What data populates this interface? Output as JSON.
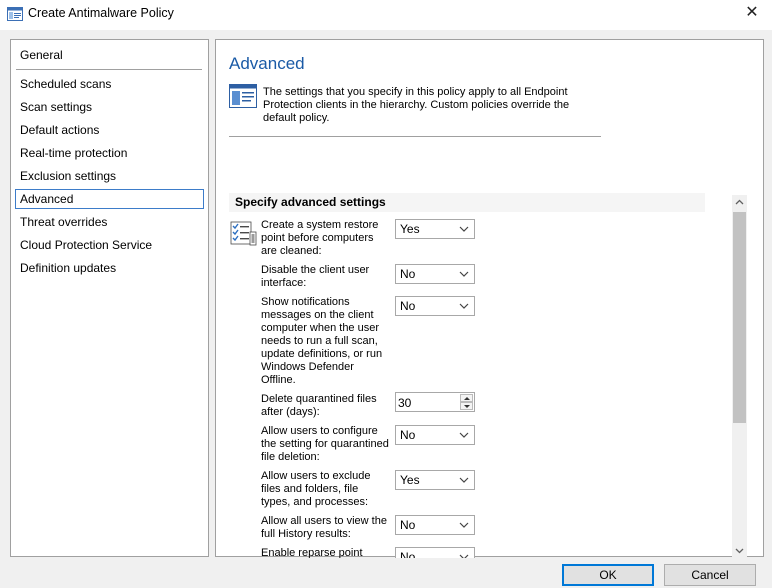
{
  "window": {
    "title": "Create Antimalware Policy",
    "close_glyph": "✕"
  },
  "nav": {
    "items": [
      {
        "label": "General",
        "selected": false
      },
      {
        "label": "Scheduled scans",
        "selected": false
      },
      {
        "label": "Scan settings",
        "selected": false
      },
      {
        "label": "Default actions",
        "selected": false
      },
      {
        "label": "Real-time protection",
        "selected": false
      },
      {
        "label": "Exclusion settings",
        "selected": false
      },
      {
        "label": "Advanced",
        "selected": true
      },
      {
        "label": "Threat overrides",
        "selected": false
      },
      {
        "label": "Cloud Protection Service",
        "selected": false
      },
      {
        "label": "Definition updates",
        "selected": false
      }
    ]
  },
  "panel": {
    "title": "Advanced",
    "info": "The settings that you specify in this policy apply to all Endpoint Protection clients in the hierarchy. Custom policies override the default policy.",
    "section_header": "Specify advanced settings",
    "settings": [
      {
        "label": "Create a system restore point before computers are cleaned:",
        "type": "dropdown",
        "value": "Yes"
      },
      {
        "label": "Disable the client user interface:",
        "type": "dropdown",
        "value": "No"
      },
      {
        "label": "Show notifications messages on the client computer when the user needs to run a full scan, update definitions, or run Windows Defender Offline.",
        "type": "dropdown",
        "value": "No"
      },
      {
        "label": "Delete quarantined files after (days):",
        "type": "spinner",
        "value": "30"
      },
      {
        "label": "Allow users to configure the setting for quarantined file deletion:",
        "type": "dropdown",
        "value": "No"
      },
      {
        "label": "Allow users to exclude files and folders, file types, and processes:",
        "type": "dropdown",
        "value": "Yes"
      },
      {
        "label": "Allow all users to view the full History results:",
        "type": "dropdown",
        "value": "No"
      },
      {
        "label": "Enable reparse point",
        "type": "dropdown",
        "value": "No"
      }
    ]
  },
  "buttons": {
    "ok": "OK",
    "cancel": "Cancel"
  },
  "colors": {
    "accent": "#0078d7",
    "title_blue": "#1a5aa6",
    "selection_border": "#3d7cc9"
  },
  "icons": {
    "app": "policy-window-icon",
    "info": "policy-document-icon",
    "settings": "settings-checklist-icon",
    "dropdown": "chevron-down-icon"
  }
}
